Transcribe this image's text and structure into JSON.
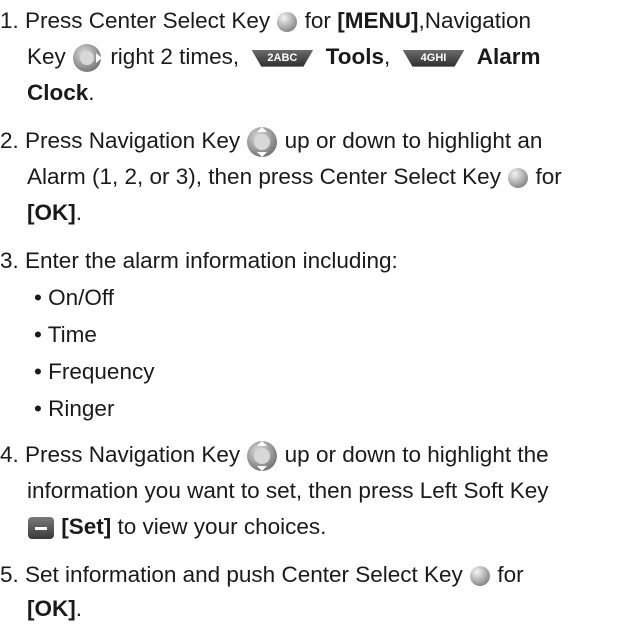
{
  "steps": [
    {
      "num": "1.",
      "l1a": "Press Center Select Key",
      "l1b": "for",
      "l1c": "[MENU]",
      "l1d": ",Navigation",
      "l2a": "Key",
      "l2b": "right 2 times,",
      "key2": "2ABC",
      "l2c": "Tools",
      "l2d": ",",
      "key4": "4GHI",
      "l2e": "Alarm",
      "l3a": "Clock",
      "l3b": "."
    },
    {
      "num": "2.",
      "l1a": "Press Navigation Key",
      "l1b": "up or down to highlight an",
      "l2a": "Alarm (1, 2, or 3), then press Center Select Key",
      "l2b": "for",
      "l3a": "[OK]",
      "l3b": "."
    },
    {
      "num": "3.",
      "l1a": "Enter the alarm information including:",
      "bullets": [
        "On/Off",
        "Time",
        "Frequency",
        "Ringer"
      ]
    },
    {
      "num": "4.",
      "l1a": "Press Navigation Key",
      "l1b": "up or down to highlight the",
      "l2a": "information you want to set, then press Left Soft Key",
      "l3a": "[Set]",
      "l3b": "to view your choices."
    },
    {
      "num": "5.",
      "l1a": "Set information and push Center Select Key",
      "l1b": "for",
      "l2a": "[OK]",
      "l2b": "."
    }
  ],
  "bullet_char": "•",
  "icons": {
    "center_select": "center-select-key-icon",
    "nav_right": "navigation-key-right-icon",
    "nav_updown": "navigation-key-updown-icon",
    "left_soft": "left-soft-key-icon",
    "key_2": "key-2abc-icon",
    "key_4": "key-4ghi-icon"
  }
}
